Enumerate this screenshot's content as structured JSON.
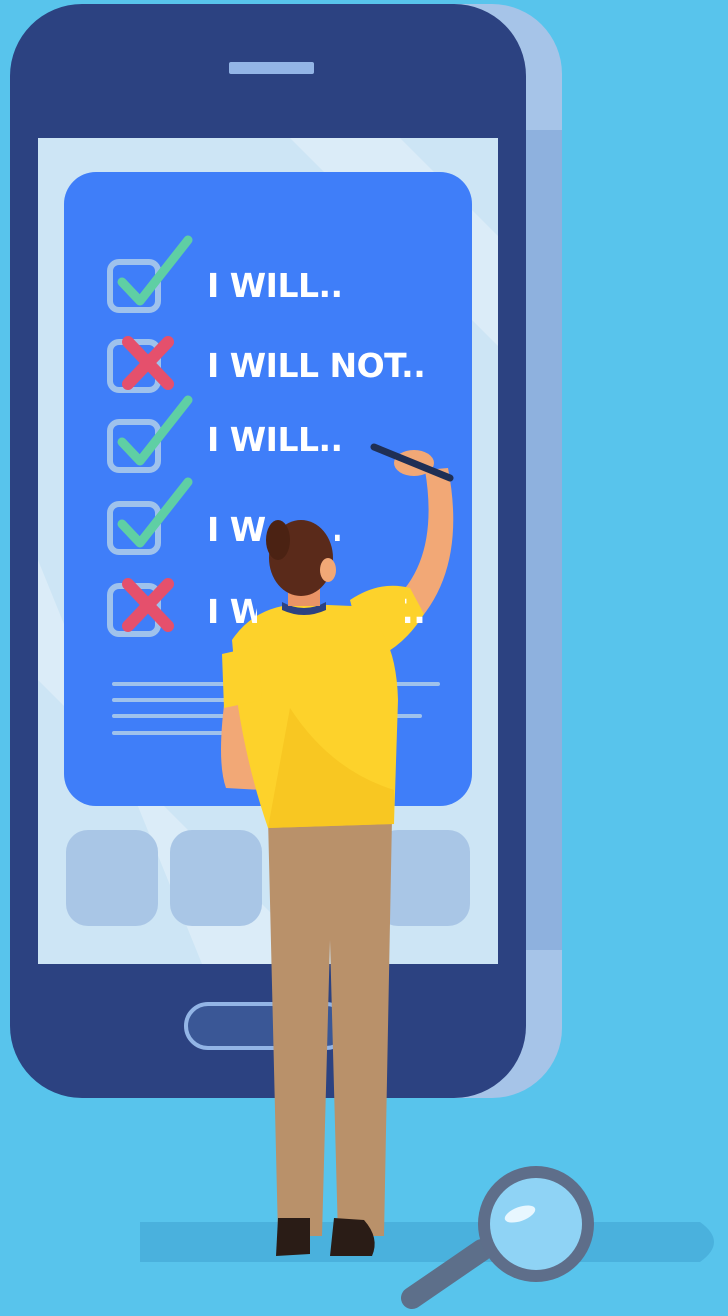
{
  "colors": {
    "background": "#58c4ec",
    "phone_body": "#2c4281",
    "phone_shadow": "#a6c4e8",
    "screen": "#cde5f5",
    "card": "#3f7ef9",
    "app_tile": "#a9c6e6",
    "checkbox_border": "#9fc2ec",
    "check_mark": "#5fcfa4",
    "cross_mark": "#e5506c",
    "shirt": "#fdd22b",
    "pants": "#b9916a",
    "hair": "#5a2a1a",
    "skin": "#f2a876"
  },
  "checklist": [
    {
      "text": "I WILL..",
      "mark": "check"
    },
    {
      "text": "I WILL NOT..",
      "mark": "cross"
    },
    {
      "text": "I WILL..",
      "mark": "check"
    },
    {
      "text": "I WILL..",
      "mark": "check"
    },
    {
      "text": "I WILL NOT..",
      "mark": "cross"
    }
  ],
  "icons": {
    "check": "check-mark-icon",
    "cross": "cross-mark-icon",
    "pen": "pen-icon",
    "magnifier": "magnifying-glass-icon"
  }
}
